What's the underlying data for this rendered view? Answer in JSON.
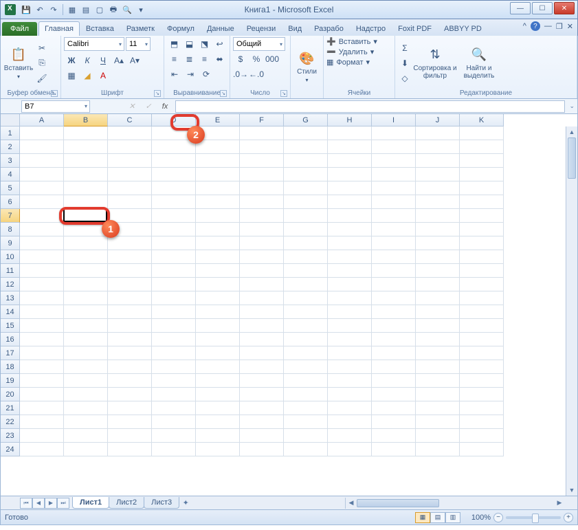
{
  "title": "Книга1 - Microsoft Excel",
  "tabs": {
    "file": "Файл",
    "items": [
      "Главная",
      "Вставка",
      "Разметк",
      "Формул",
      "Данные",
      "Рецензи",
      "Вид",
      "Разрабо",
      "Надстро",
      "Foxit PDF",
      "ABBYY PD"
    ],
    "active_index": 0
  },
  "ribbon": {
    "clipboard": {
      "paste": "Вставить",
      "label": "Буфер обмена"
    },
    "font": {
      "name": "Calibri",
      "size": "11",
      "label": "Шрифт"
    },
    "alignment": {
      "label": "Выравнивание"
    },
    "number": {
      "format": "Общий",
      "label": "Число"
    },
    "styles": {
      "btn": "Стили",
      "label": ""
    },
    "cells": {
      "insert": "Вставить",
      "delete": "Удалить",
      "format": "Формат",
      "label": "Ячейки"
    },
    "editing": {
      "sort": "Сортировка и фильтр",
      "find": "Найти и выделить",
      "label": "Редактирование"
    }
  },
  "namebox": "B7",
  "columns": [
    "A",
    "B",
    "C",
    "D",
    "E",
    "F",
    "G",
    "H",
    "I",
    "J",
    "K"
  ],
  "rows": [
    "1",
    "2",
    "3",
    "4",
    "5",
    "6",
    "7",
    "8",
    "9",
    "10",
    "11",
    "12",
    "13",
    "14",
    "15",
    "16",
    "17",
    "18",
    "19",
    "20",
    "21",
    "22",
    "23",
    "24"
  ],
  "selected": {
    "col": "B",
    "row": "7"
  },
  "sheets": {
    "items": [
      "Лист1",
      "Лист2",
      "Лист3"
    ],
    "active_index": 0
  },
  "status": "Готово",
  "zoom": "100%",
  "callouts": {
    "1": "1",
    "2": "2"
  }
}
